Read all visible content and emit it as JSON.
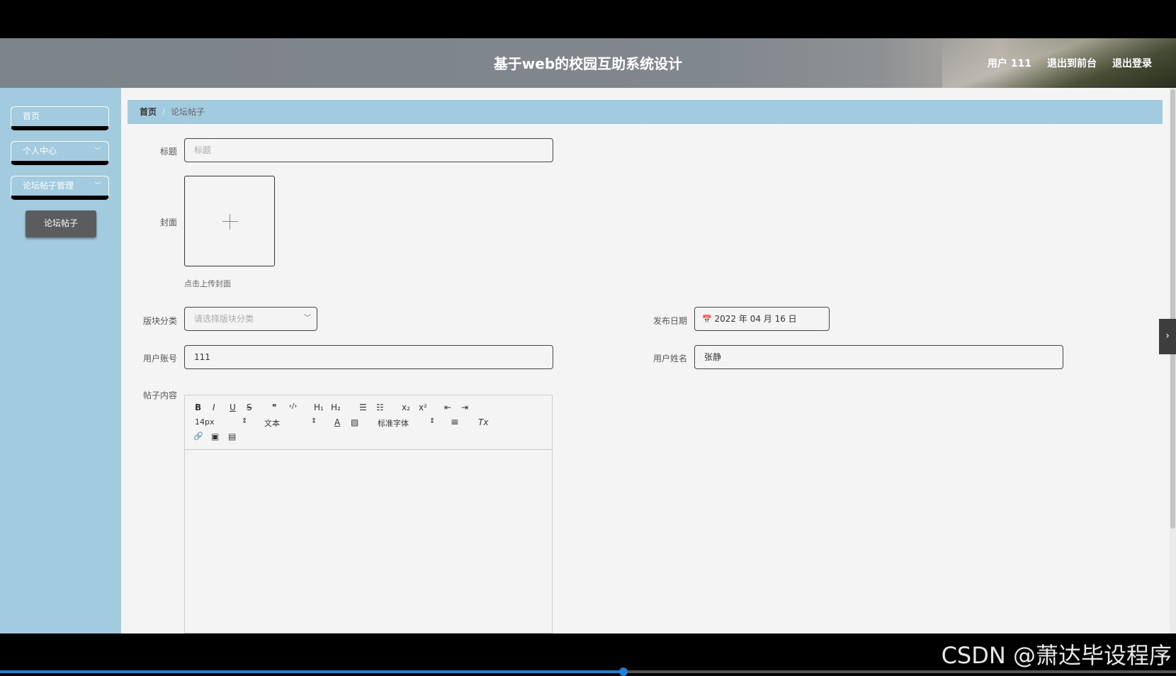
{
  "header": {
    "title": "基于web的校园互助系统设计",
    "user_label": "用户 111",
    "to_front": "退出到前台",
    "logout": "退出登录"
  },
  "sidebar": {
    "items": [
      {
        "label": "首页"
      },
      {
        "label": "个人中心",
        "chevron": "﹀"
      },
      {
        "label": "论坛帖子管理",
        "chevron": "﹀"
      }
    ],
    "submenu": {
      "label": "论坛帖子"
    }
  },
  "breadcrumb": {
    "home": "首页",
    "separator": "/",
    "current": "论坛帖子"
  },
  "form": {
    "title_label": "标题",
    "title_placeholder": "标题",
    "cover_label": "封面",
    "cover_hint": "点击上传封面",
    "category_label": "版块分类",
    "category_placeholder": "请选择版块分类",
    "date_label": "发布日期",
    "date_value": "2022 年 04 月 16 日",
    "account_label": "用户账号",
    "account_value": "111",
    "name_label": "用户姓名",
    "name_value": "张静",
    "content_label": "帖子内容"
  },
  "editor": {
    "bold": "B",
    "italic": "I",
    "underline": "U",
    "strike": "S",
    "quote": "❞",
    "code": "‹/›",
    "h1": "H₁",
    "h2": "H₂",
    "ol": "☰",
    "ul": "☷",
    "sub": "x₂",
    "sup": "x²",
    "outdent": "⇤",
    "indent": "⇥",
    "size": "14px",
    "size_arrow": "⇕",
    "heading": "文本",
    "heading_arrow": "⇕",
    "color": "A",
    "bg": "▨",
    "font": "标准字体",
    "font_arrow": "⇕",
    "align": "≡",
    "clear": "Tx",
    "link": "🔗",
    "image": "▣",
    "video": "▤"
  },
  "watermark": "CSDN @萧达毕设程序"
}
